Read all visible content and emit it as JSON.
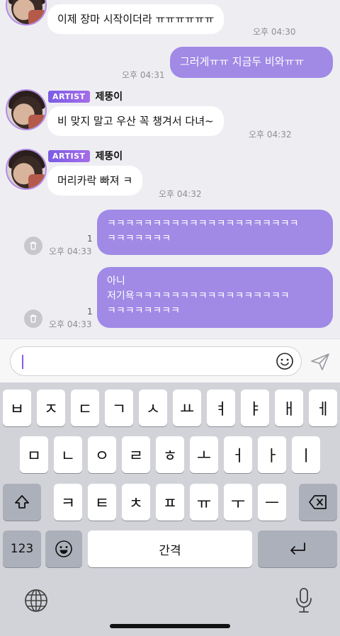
{
  "messages": {
    "m1": {
      "text": "이제 장마 시작이더라 ㅠㅠㅠㅠㅠㅠ",
      "time": "오후 04:30"
    },
    "m2": {
      "text": "그러게ㅠㅠ 지금두 비와ㅠㅠ",
      "time": "오후 04:31"
    },
    "m3": {
      "badge": "ARTIST",
      "name": "제뚱이",
      "text": "비 맞지 말고 우산 꼭 챙겨서 다녀~",
      "time": "오후 04:32"
    },
    "m4": {
      "badge": "ARTIST",
      "name": "제뚱이",
      "text": "머리카락 빠져 ㅋ",
      "time": "오후 04:32"
    },
    "m5": {
      "text": "ㅋㅋㅋㅋㅋㅋㅋㅋㅋㅋㅋㅋㅋㅋㅋㅋㅋㅋㅋㅋㅋ\nㅋㅋㅋㅋㅋㅋㅋ",
      "time": "오후 04:33",
      "unread": "1"
    },
    "m6": {
      "text": "아니\n저기욕ㅋㅋㅋㅋㅋㅋㅋㅋㅋㅋㅋㅋㅋㅋㅋㅋㅋ\nㅋㅋㅋㅋㅋㅋㅋㅋ",
      "time": "오후 04:33",
      "unread": "1"
    }
  },
  "input": {
    "value": ""
  },
  "keyboard": {
    "row1": [
      "ㅂ",
      "ㅈ",
      "ㄷ",
      "ㄱ",
      "ㅅ",
      "ㅛ",
      "ㅕ",
      "ㅑ",
      "ㅐ",
      "ㅔ"
    ],
    "row2": [
      "ㅁ",
      "ㄴ",
      "ㅇ",
      "ㄹ",
      "ㅎ",
      "ㅗ",
      "ㅓ",
      "ㅏ",
      "ㅣ"
    ],
    "row3": [
      "ㅋ",
      "ㅌ",
      "ㅊ",
      "ㅍ",
      "ㅠ",
      "ㅜ",
      "ㅡ"
    ],
    "numbers_label": "123",
    "space_label": "간격"
  }
}
